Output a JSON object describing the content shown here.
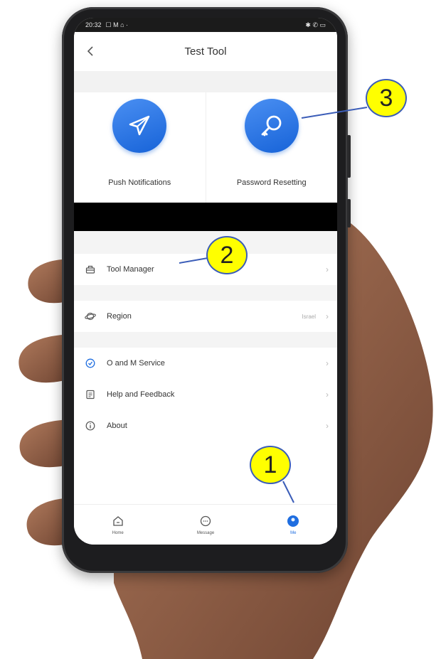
{
  "status_bar": {
    "time": "20:32",
    "left_icons": "☐ M ⌂ ·",
    "right_icons": "✱ ✆ ▭"
  },
  "nav": {
    "title": "Test Tool",
    "back_icon": "chevron-left-icon"
  },
  "tiles": [
    {
      "label": "Push Notifications",
      "icon": "paper-plane-icon"
    },
    {
      "label": "Password Resetting",
      "icon": "key-icon"
    }
  ],
  "menu": {
    "tool_manager": {
      "label": "Tool Manager",
      "icon": "toolbox-icon"
    },
    "region": {
      "label": "Region",
      "value": "Israel",
      "icon": "planet-icon"
    },
    "om_service": {
      "label": "O and M Service",
      "icon": "service-icon"
    },
    "help": {
      "label": "Help and Feedback",
      "icon": "feedback-icon"
    },
    "about": {
      "label": "About",
      "icon": "info-icon"
    }
  },
  "tabbar": {
    "home": {
      "label": "Home",
      "icon": "home-icon"
    },
    "message": {
      "label": "Message",
      "icon": "message-icon"
    },
    "me": {
      "label": "Me",
      "icon": "me-icon",
      "active": true
    }
  },
  "callouts": {
    "one": "1",
    "two": "2",
    "three": "3"
  },
  "colors": {
    "accent": "#1f6ee0",
    "callout_fill": "#ffff00",
    "callout_border": "#3b5db8"
  }
}
